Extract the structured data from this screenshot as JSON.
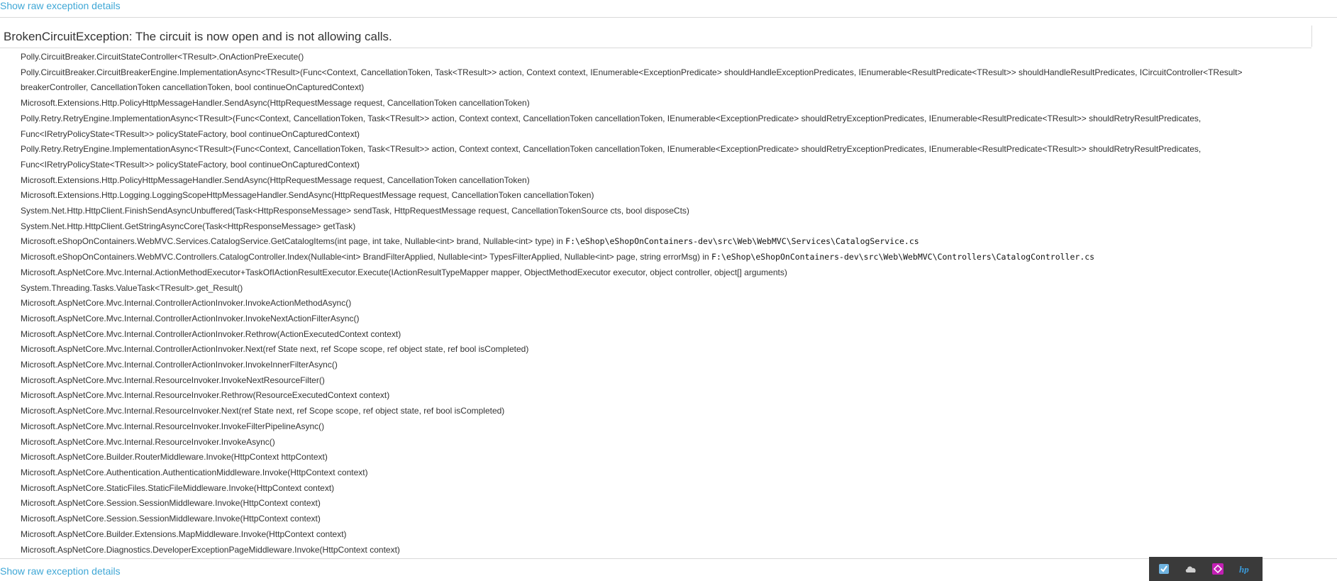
{
  "links": {
    "show_raw_top": "Show raw exception details",
    "show_raw_bottom": "Show raw exception details"
  },
  "exception": {
    "title": "BrokenCircuitException: The circuit is now open and is not allowing calls."
  },
  "frames": [
    {
      "method": "Polly.CircuitBreaker.CircuitStateController<TResult>.OnActionPreExecute()",
      "location": ""
    },
    {
      "method": "Polly.CircuitBreaker.CircuitBreakerEngine.ImplementationAsync<TResult>(Func<Context, CancellationToken, Task<TResult>> action, Context context, IEnumerable<ExceptionPredicate> shouldHandleExceptionPredicates, IEnumerable<ResultPredicate<TResult>> shouldHandleResultPredicates, ICircuitController<TResult> breakerController, CancellationToken cancellationToken, bool continueOnCapturedContext)",
      "location": ""
    },
    {
      "method": "Microsoft.Extensions.Http.PolicyHttpMessageHandler.SendAsync(HttpRequestMessage request, CancellationToken cancellationToken)",
      "location": ""
    },
    {
      "method": "Polly.Retry.RetryEngine.ImplementationAsync<TResult>(Func<Context, CancellationToken, Task<TResult>> action, Context context, CancellationToken cancellationToken, IEnumerable<ExceptionPredicate> shouldRetryExceptionPredicates, IEnumerable<ResultPredicate<TResult>> shouldRetryResultPredicates, Func<IRetryPolicyState<TResult>> policyStateFactory, bool continueOnCapturedContext)",
      "location": ""
    },
    {
      "method": "Polly.Retry.RetryEngine.ImplementationAsync<TResult>(Func<Context, CancellationToken, Task<TResult>> action, Context context, CancellationToken cancellationToken, IEnumerable<ExceptionPredicate> shouldRetryExceptionPredicates, IEnumerable<ResultPredicate<TResult>> shouldRetryResultPredicates, Func<IRetryPolicyState<TResult>> policyStateFactory, bool continueOnCapturedContext)",
      "location": ""
    },
    {
      "method": "Microsoft.Extensions.Http.PolicyHttpMessageHandler.SendAsync(HttpRequestMessage request, CancellationToken cancellationToken)",
      "location": ""
    },
    {
      "method": "Microsoft.Extensions.Http.Logging.LoggingScopeHttpMessageHandler.SendAsync(HttpRequestMessage request, CancellationToken cancellationToken)",
      "location": ""
    },
    {
      "method": "System.Net.Http.HttpClient.FinishSendAsyncUnbuffered(Task<HttpResponseMessage> sendTask, HttpRequestMessage request, CancellationTokenSource cts, bool disposeCts)",
      "location": ""
    },
    {
      "method": "System.Net.Http.HttpClient.GetStringAsyncCore(Task<HttpResponseMessage> getTask)",
      "location": ""
    },
    {
      "method": "Microsoft.eShopOnContainers.WebMVC.Services.CatalogService.GetCatalogItems(int page, int take, Nullable<int> brand, Nullable<int> type) in ",
      "location": "F:\\eShop\\eShopOnContainers-dev\\src\\Web\\WebMVC\\Services\\CatalogService.cs"
    },
    {
      "method": "Microsoft.eShopOnContainers.WebMVC.Controllers.CatalogController.Index(Nullable<int> BrandFilterApplied, Nullable<int> TypesFilterApplied, Nullable<int> page, string errorMsg) in ",
      "location": "F:\\eShop\\eShopOnContainers-dev\\src\\Web\\WebMVC\\Controllers\\CatalogController.cs"
    },
    {
      "method": "Microsoft.AspNetCore.Mvc.Internal.ActionMethodExecutor+TaskOfIActionResultExecutor.Execute(IActionResultTypeMapper mapper, ObjectMethodExecutor executor, object controller, object[] arguments)",
      "location": ""
    },
    {
      "method": "System.Threading.Tasks.ValueTask<TResult>.get_Result()",
      "location": ""
    },
    {
      "method": "Microsoft.AspNetCore.Mvc.Internal.ControllerActionInvoker.InvokeActionMethodAsync()",
      "location": ""
    },
    {
      "method": "Microsoft.AspNetCore.Mvc.Internal.ControllerActionInvoker.InvokeNextActionFilterAsync()",
      "location": ""
    },
    {
      "method": "Microsoft.AspNetCore.Mvc.Internal.ControllerActionInvoker.Rethrow(ActionExecutedContext context)",
      "location": ""
    },
    {
      "method": "Microsoft.AspNetCore.Mvc.Internal.ControllerActionInvoker.Next(ref State next, ref Scope scope, ref object state, ref bool isCompleted)",
      "location": ""
    },
    {
      "method": "Microsoft.AspNetCore.Mvc.Internal.ControllerActionInvoker.InvokeInnerFilterAsync()",
      "location": ""
    },
    {
      "method": "Microsoft.AspNetCore.Mvc.Internal.ResourceInvoker.InvokeNextResourceFilter()",
      "location": ""
    },
    {
      "method": "Microsoft.AspNetCore.Mvc.Internal.ResourceInvoker.Rethrow(ResourceExecutedContext context)",
      "location": ""
    },
    {
      "method": "Microsoft.AspNetCore.Mvc.Internal.ResourceInvoker.Next(ref State next, ref Scope scope, ref object state, ref bool isCompleted)",
      "location": ""
    },
    {
      "method": "Microsoft.AspNetCore.Mvc.Internal.ResourceInvoker.InvokeFilterPipelineAsync()",
      "location": ""
    },
    {
      "method": "Microsoft.AspNetCore.Mvc.Internal.ResourceInvoker.InvokeAsync()",
      "location": ""
    },
    {
      "method": "Microsoft.AspNetCore.Builder.RouterMiddleware.Invoke(HttpContext httpContext)",
      "location": ""
    },
    {
      "method": "Microsoft.AspNetCore.Authentication.AuthenticationMiddleware.Invoke(HttpContext context)",
      "location": ""
    },
    {
      "method": "Microsoft.AspNetCore.StaticFiles.StaticFileMiddleware.Invoke(HttpContext context)",
      "location": ""
    },
    {
      "method": "Microsoft.AspNetCore.Session.SessionMiddleware.Invoke(HttpContext context)",
      "location": ""
    },
    {
      "method": "Microsoft.AspNetCore.Session.SessionMiddleware.Invoke(HttpContext context)",
      "location": ""
    },
    {
      "method": "Microsoft.AspNetCore.Builder.Extensions.MapMiddleware.Invoke(HttpContext context)",
      "location": ""
    },
    {
      "method": "Microsoft.AspNetCore.Diagnostics.DeveloperExceptionPageMiddleware.Invoke(HttpContext context)",
      "location": ""
    }
  ],
  "tray": {
    "icons": [
      {
        "name": "shield-check-icon",
        "color": "#6fb3e0"
      },
      {
        "name": "cloud-icon",
        "color": "#cfcfcf"
      },
      {
        "name": "diamond-app-icon",
        "color": "#c21fb4"
      },
      {
        "name": "hp-icon",
        "color": "#3a9ad9"
      }
    ]
  }
}
